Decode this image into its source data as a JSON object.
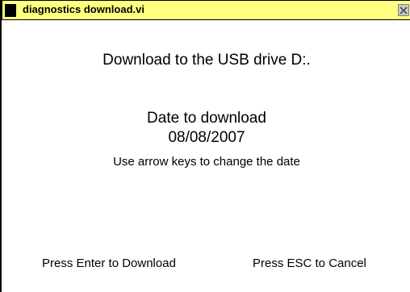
{
  "window": {
    "title": "diagnostics download.vi",
    "title_bar_color": "#ffff80",
    "icons": {
      "app_icon": "black-square-icon",
      "close_icon": "close-icon"
    }
  },
  "content": {
    "heading": "Download to the USB drive D:.",
    "date_label": "Date to download",
    "date_value": "08/08/2007",
    "hint": "Use arrow keys to change the date",
    "enter_hint": "Press Enter to Download",
    "esc_hint": "Press ESC to Cancel"
  }
}
